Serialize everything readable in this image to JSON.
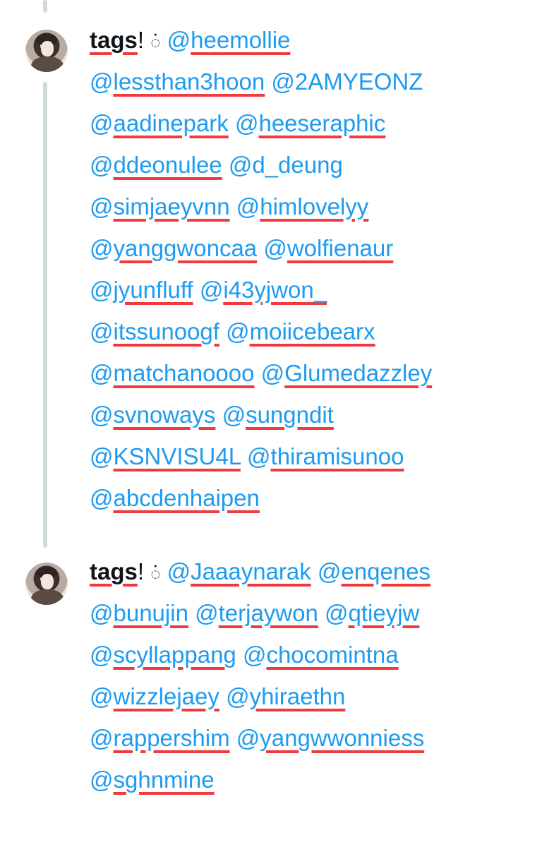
{
  "tweets": [
    {
      "name": "tags",
      "punct": "!",
      "emoji": "ꩌ",
      "lines": [
        [
          "@heemollie"
        ],
        [
          "@lessthan3hoon",
          "@2AMYEONZ"
        ],
        [
          "@aadinepark",
          "@heeseraphic"
        ],
        [
          "@ddeonulee",
          "@d_deung"
        ],
        [
          "@simjaeyvnn",
          "@himlovelyy"
        ],
        [
          "@yanggwoncaa",
          "@wolfienaur"
        ],
        [
          "@jyunfluff",
          "@i43yjwon_"
        ],
        [
          "@itssunoogf",
          "@moiicebearx"
        ],
        [
          "@matchanoooo",
          "@Glumedazzley"
        ],
        [
          "@svnoways",
          "@sungndit"
        ],
        [
          "@KSNVISU4L",
          "@thiramisunoo"
        ],
        [
          "@abcdenhaipen"
        ]
      ],
      "underlined": [
        "@heemollie",
        "@lessthan3hoon",
        "@aadinepark",
        "@heeseraphic",
        "@ddeonulee",
        "@simjaeyvnn",
        "@himlovelyy",
        "@yanggwoncaa",
        "@wolfienaur",
        "@jyunfluff",
        "@i43yjwon_",
        "@itssunoogf",
        "@moiicebearx",
        "@matchanoooo",
        "@Glumedazzley",
        "@svnoways",
        "@sungndit",
        "@KSNVISU4L",
        "@thiramisunoo",
        "@abcdenhaipen"
      ]
    },
    {
      "name": "tags",
      "punct": "!",
      "emoji": "ꩌ",
      "lines": [
        [
          "@Jaaaynarak",
          "@enqenes"
        ],
        [
          "@bunujin",
          "@terjaywon",
          "@qtieyjw"
        ],
        [
          "@scyllappang",
          "@chocomintna"
        ],
        [
          "@wizzlejaey",
          "@yhiraethn"
        ],
        [
          "@rappershim",
          "@yangwwonniess"
        ],
        [
          "@sghnmine"
        ]
      ],
      "underlined": [
        "@Jaaaynarak",
        "@enqenes",
        "@bunujin",
        "@terjaywon",
        "@qtieyjw",
        "@scyllappang",
        "@chocomintna",
        "@wizzlejaey",
        "@yhiraethn",
        "@rappershim",
        "@yangwwonniess",
        "@sghnmine"
      ]
    }
  ],
  "colors": {
    "mention": "#1d9bf0",
    "highlight_underline": "#ef3b3f",
    "thread_line": "#cfd9de",
    "text": "#0f1419"
  }
}
